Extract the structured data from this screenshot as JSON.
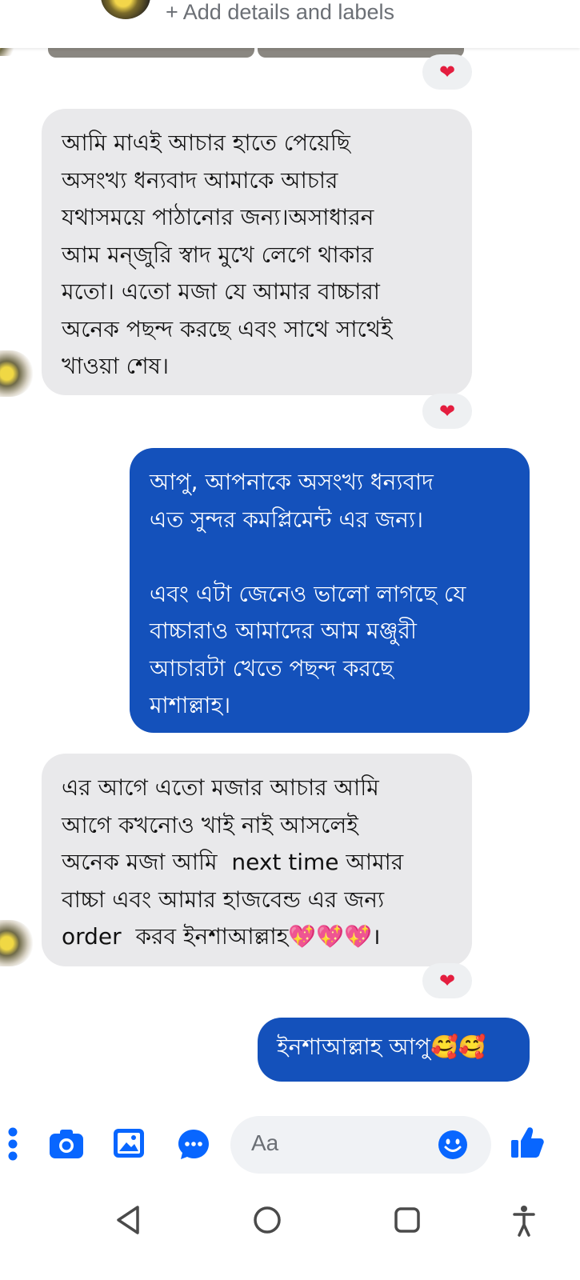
{
  "header": {
    "add_details": "+ Add details and labels"
  },
  "messages": [
    {
      "direction": "incoming",
      "text": "আমি মাএই আচার হাতে পেয়েছি\nঅসংখ্য ধন্যবাদ আমাকে আচার\nযথাসময়ে পাঠানোর জন্য।অসাধারন\nআম মন্জুরি স্বাদ মুখে লেগে থাকার\nমতো। এতো মজা যে আমার বাচ্চারা\nঅনেক পছন্দ করছে এবং সাথে সাথেই\nখাওয়া শেষ।",
      "reaction": "❤"
    },
    {
      "direction": "outgoing",
      "text": "আপু, আপনাকে অসংখ্য ধন্যবাদ\nএত সুন্দর কমপ্লিমেন্ট এর জন্য।\n\nএবং এটা জেনেও ভালো লাগছে যে\nবাচ্চারাও আমাদের আম মঞ্জুরী\nআচারটা খেতে পছন্দ করছে\nমাশাল্লাহ।"
    },
    {
      "direction": "incoming",
      "text": "এর আগে এতো মজার আচার আমি\nআগে কখনোও খাই নাই আসলেই\nঅনেক মজা আমি  next time আমার\nবাচ্চা এবং আমার হাজবেন্ড এর জন্য\norder  করব ইনশাআল্লাহ💖💖💖।",
      "reaction": "❤"
    },
    {
      "direction": "outgoing",
      "text": "ইনশাআল্লাহ আপু🥰🥰"
    }
  ],
  "top_reaction": "❤",
  "composer": {
    "placeholder": "Aa",
    "accent_color": "#0866ff"
  },
  "colors": {
    "outgoing_bubble": "#1451bb",
    "incoming_bubble": "#e9e9eb",
    "reaction_heart": "#e41e3f"
  }
}
